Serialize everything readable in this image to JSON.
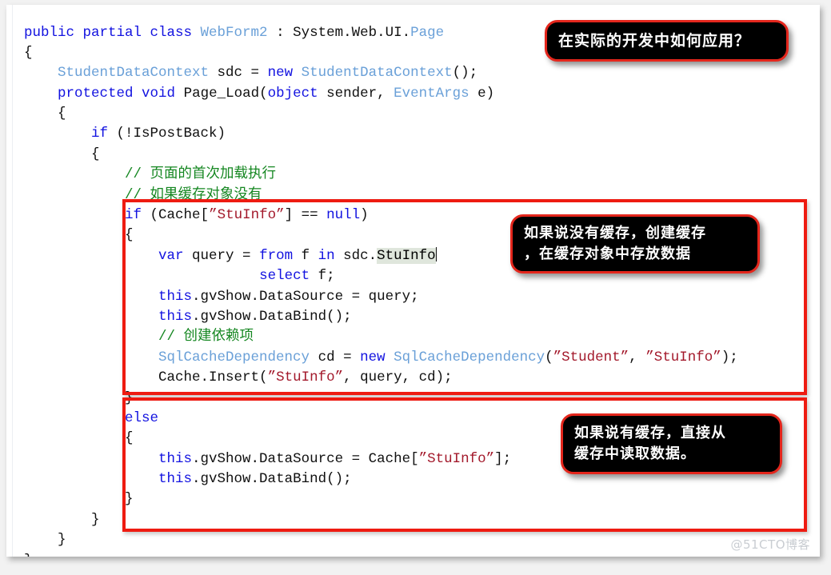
{
  "editor": {
    "language": "csharp",
    "selection_text": "StuInfo",
    "lines": [
      {
        "id": "l1",
        "indent": 0,
        "tokens": [
          {
            "t": "public ",
            "c": "kw"
          },
          {
            "t": "partial ",
            "c": "kw"
          },
          {
            "t": "class ",
            "c": "kw"
          },
          {
            "t": "WebForm2",
            "c": "typ"
          },
          {
            "t": " : System.Web.UI.",
            "c": "pln"
          },
          {
            "t": "Page",
            "c": "typ"
          }
        ]
      },
      {
        "id": "l2",
        "indent": 0,
        "tokens": [
          {
            "t": "{",
            "c": "pln"
          }
        ]
      },
      {
        "id": "l3",
        "indent": 1,
        "tokens": [
          {
            "t": "StudentDataContext",
            "c": "typ"
          },
          {
            "t": " sdc = ",
            "c": "pln"
          },
          {
            "t": "new",
            "c": "kw"
          },
          {
            "t": " ",
            "c": "pln"
          },
          {
            "t": "StudentDataContext",
            "c": "typ"
          },
          {
            "t": "();",
            "c": "pln"
          }
        ]
      },
      {
        "id": "l4",
        "indent": 1,
        "tokens": [
          {
            "t": "protected ",
            "c": "kw"
          },
          {
            "t": "void",
            "c": "kw"
          },
          {
            "t": " Page_Load(",
            "c": "pln"
          },
          {
            "t": "object",
            "c": "kw"
          },
          {
            "t": " sender, ",
            "c": "pln"
          },
          {
            "t": "EventArgs",
            "c": "typ"
          },
          {
            "t": " e)",
            "c": "pln"
          }
        ]
      },
      {
        "id": "l5",
        "indent": 1,
        "tokens": [
          {
            "t": "{",
            "c": "pln"
          }
        ]
      },
      {
        "id": "l6",
        "indent": 2,
        "tokens": [
          {
            "t": "if",
            "c": "kw"
          },
          {
            "t": " (!IsPostBack)",
            "c": "pln"
          }
        ]
      },
      {
        "id": "l7",
        "indent": 2,
        "tokens": [
          {
            "t": "{",
            "c": "pln"
          }
        ]
      },
      {
        "id": "l8",
        "indent": 3,
        "tokens": [
          {
            "t": "// 页面的首次加载执行",
            "c": "cmt"
          }
        ]
      },
      {
        "id": "l9",
        "indent": 3,
        "tokens": [
          {
            "t": "// 如果缓存对象没有",
            "c": "cmt"
          }
        ]
      },
      {
        "id": "l10",
        "indent": 3,
        "tokens": [
          {
            "t": "if",
            "c": "kw"
          },
          {
            "t": " (Cache[",
            "c": "pln"
          },
          {
            "t": "”StuInfo”",
            "c": "str"
          },
          {
            "t": "] == ",
            "c": "pln"
          },
          {
            "t": "null",
            "c": "kw"
          },
          {
            "t": ")",
            "c": "pln"
          }
        ]
      },
      {
        "id": "l11",
        "indent": 3,
        "tokens": [
          {
            "t": "{",
            "c": "pln"
          }
        ]
      },
      {
        "id": "l12",
        "indent": 4,
        "tokens": [
          {
            "t": "var",
            "c": "kw"
          },
          {
            "t": " query = ",
            "c": "pln"
          },
          {
            "t": "from",
            "c": "kw"
          },
          {
            "t": " f ",
            "c": "pln"
          },
          {
            "t": "in",
            "c": "kw"
          },
          {
            "t": " sdc.",
            "c": "pln"
          },
          {
            "t": "StuInfo",
            "c": "sel"
          },
          {
            "t": "",
            "c": "caret"
          }
        ]
      },
      {
        "id": "l13",
        "indent": 7,
        "tokens": [
          {
            "t": "select",
            "c": "kw"
          },
          {
            "t": " f;",
            "c": "pln"
          }
        ]
      },
      {
        "id": "l14",
        "indent": 4,
        "tokens": [
          {
            "t": "this",
            "c": "kw"
          },
          {
            "t": ".gvShow.DataSource = query;",
            "c": "pln"
          }
        ]
      },
      {
        "id": "l15",
        "indent": 4,
        "tokens": [
          {
            "t": "this",
            "c": "kw"
          },
          {
            "t": ".gvShow.DataBind();",
            "c": "pln"
          }
        ]
      },
      {
        "id": "l16",
        "indent": 4,
        "tokens": [
          {
            "t": "// 创建依赖项",
            "c": "cmt"
          }
        ]
      },
      {
        "id": "l17",
        "indent": 4,
        "tokens": [
          {
            "t": "SqlCacheDependency",
            "c": "typ"
          },
          {
            "t": " cd = ",
            "c": "pln"
          },
          {
            "t": "new",
            "c": "kw"
          },
          {
            "t": " ",
            "c": "pln"
          },
          {
            "t": "SqlCacheDependency",
            "c": "typ"
          },
          {
            "t": "(",
            "c": "pln"
          },
          {
            "t": "”Student”",
            "c": "str"
          },
          {
            "t": ", ",
            "c": "pln"
          },
          {
            "t": "”StuInfo”",
            "c": "str"
          },
          {
            "t": ");",
            "c": "pln"
          }
        ]
      },
      {
        "id": "l18",
        "indent": 4,
        "tokens": [
          {
            "t": "Cache.Insert(",
            "c": "pln"
          },
          {
            "t": "”StuInfo”",
            "c": "str"
          },
          {
            "t": ", query, cd);",
            "c": "pln"
          }
        ]
      },
      {
        "id": "l19",
        "indent": 3,
        "tokens": [
          {
            "t": "}",
            "c": "pln"
          }
        ]
      },
      {
        "id": "l20",
        "indent": 3,
        "tokens": [
          {
            "t": "else",
            "c": "kw"
          }
        ]
      },
      {
        "id": "l21",
        "indent": 3,
        "tokens": [
          {
            "t": "{",
            "c": "pln"
          }
        ]
      },
      {
        "id": "l22",
        "indent": 4,
        "tokens": [
          {
            "t": "this",
            "c": "kw"
          },
          {
            "t": ".gvShow.DataSource = Cache[",
            "c": "pln"
          },
          {
            "t": "”StuInfo”",
            "c": "str"
          },
          {
            "t": "];",
            "c": "pln"
          }
        ]
      },
      {
        "id": "l23",
        "indent": 4,
        "tokens": [
          {
            "t": "this",
            "c": "kw"
          },
          {
            "t": ".gvShow.DataBind();",
            "c": "pln"
          }
        ]
      },
      {
        "id": "l24",
        "indent": 3,
        "tokens": [
          {
            "t": "}",
            "c": "pln"
          }
        ]
      },
      {
        "id": "l25",
        "indent": 2,
        "tokens": [
          {
            "t": "}",
            "c": "pln"
          }
        ]
      },
      {
        "id": "l26",
        "indent": 1,
        "tokens": [
          {
            "t": "}",
            "c": "pln"
          }
        ]
      },
      {
        "id": "l27",
        "indent": 0,
        "tokens": [
          {
            "t": "}",
            "c": "pln"
          }
        ]
      }
    ]
  },
  "annotations": {
    "callouts": [
      {
        "id": "callout-1",
        "text": "在实际的开发中如何应用？"
      },
      {
        "id": "callout-2",
        "text": "如果说没有缓存，创建缓存\n，在缓存对象中存放数据"
      },
      {
        "id": "callout-3",
        "text": "如果说有缓存，直接从\n缓存中读取数据。"
      }
    ],
    "highlight_boxes": [
      {
        "id": "redbox-if",
        "label": "if-branch-highlight",
        "color": "#ee1b11"
      },
      {
        "id": "redbox-else",
        "label": "else-branch-highlight",
        "color": "#ee1b11"
      }
    ]
  },
  "watermark": {
    "text": "@51CTO博客"
  },
  "colors": {
    "keyword": "#1212e0",
    "type": "#6aa0d8",
    "string": "#a3192b",
    "comment": "#158721",
    "plain": "#101010",
    "selection": "#dfe6dc",
    "highlight_red": "#ee1b11",
    "callout_bg": "#000000",
    "callout_border": "#e4261c",
    "callout_text": "#ffffff",
    "page_bg": "#ffffff",
    "canvas_bg": "#f2f2f2",
    "watermark": "#c9cdd2"
  }
}
